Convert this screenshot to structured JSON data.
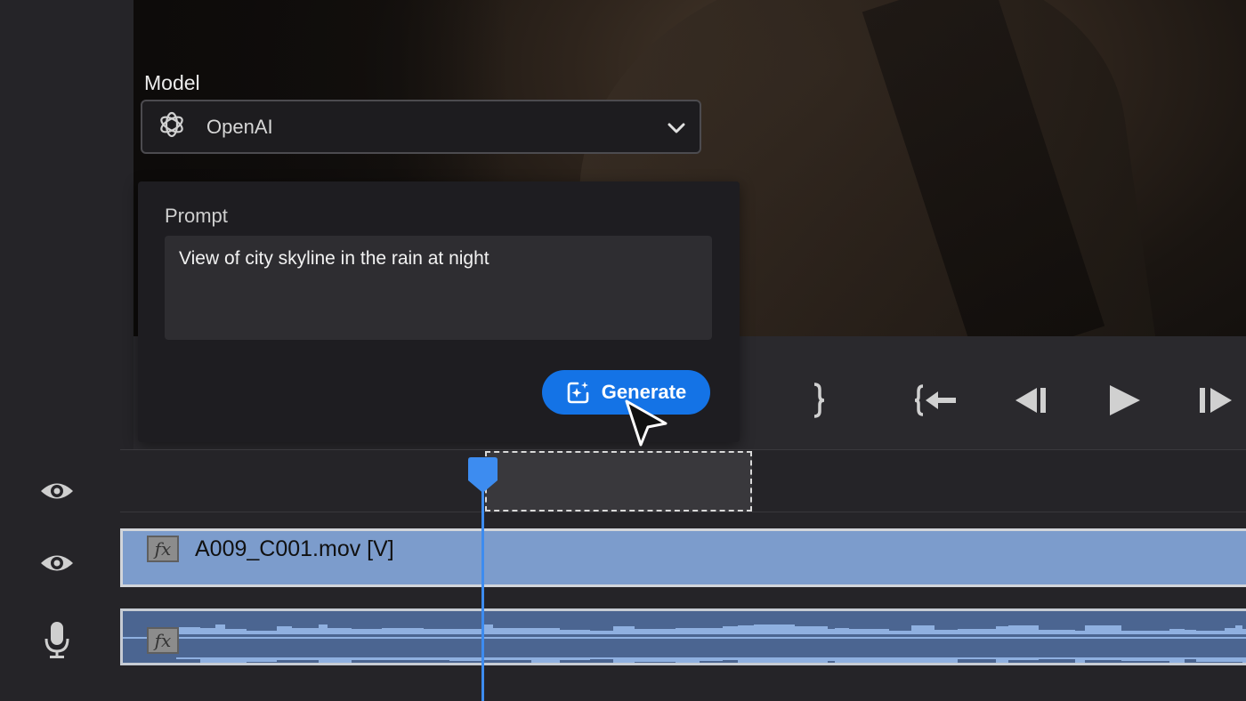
{
  "model": {
    "label": "Model",
    "selected": "OpenAI",
    "logo_icon": "openai-logo-icon"
  },
  "prompt": {
    "label": "Prompt",
    "value": "View of city skyline in the rain at night"
  },
  "generate_button": {
    "label": "Generate",
    "color": "#1473e6",
    "icon": "sparkle-generate-icon"
  },
  "transport": {
    "buttons": [
      "mark-out",
      "go-to-in",
      "step-back",
      "play",
      "step-forward"
    ]
  },
  "timeline": {
    "video_clip_name": "A009_C001.mov [V]",
    "fx_label": "fx",
    "playhead_color": "#3d8cf0",
    "video_clip_color": "#7c9ccc",
    "audio_clip_color": "#4b6591"
  }
}
